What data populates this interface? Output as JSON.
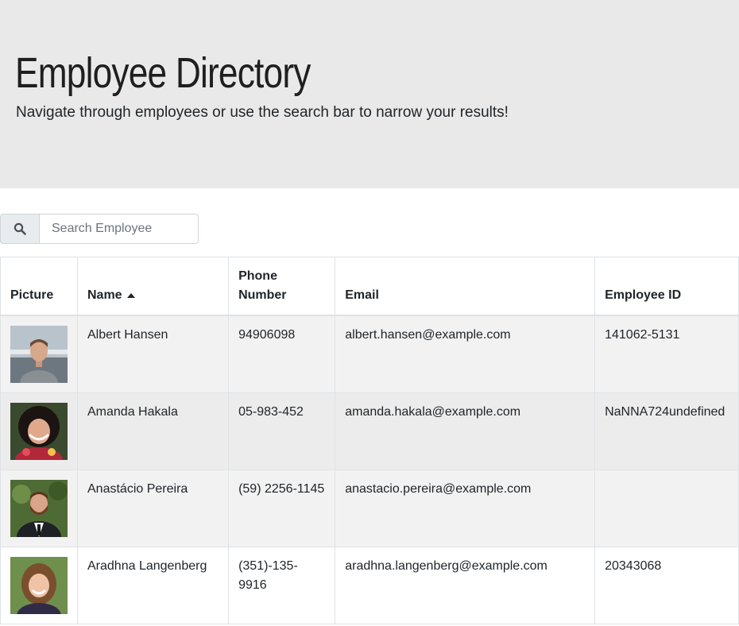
{
  "header": {
    "title": "Employee Directory",
    "subtitle": "Navigate through employees or use the search bar to narrow your results!"
  },
  "search": {
    "icon": "search-icon",
    "placeholder": "Search Employee",
    "value": ""
  },
  "table": {
    "columns": [
      "Picture",
      "Name",
      "Phone\nNumber",
      "Email",
      "Employee ID"
    ],
    "sort": {
      "column": "Name",
      "direction": "ascending",
      "icon": "caret-up-icon"
    },
    "rows": [
      {
        "name": "Albert Hansen",
        "phone": "94906098",
        "email": "albert.hansen@example.com",
        "id": "141062-5131"
      },
      {
        "name": "Amanda Hakala",
        "phone": "05-983-452",
        "email": "amanda.hakala@example.com",
        "id": "NaNNA724undefined"
      },
      {
        "name": "Anastácio Pereira",
        "phone": "(59) 2256-1145",
        "email": "anastacio.pereira@example.com",
        "id": ""
      },
      {
        "name": "Aradhna Langenberg",
        "phone": "(351)-135-9916",
        "email": "aradhna.langenberg@example.com",
        "id": "20343068"
      }
    ]
  },
  "colors": {
    "jumbotron_bg": "#e9e9e9",
    "row_stripe": "#f2f2f2",
    "border": "#dee2e6"
  }
}
